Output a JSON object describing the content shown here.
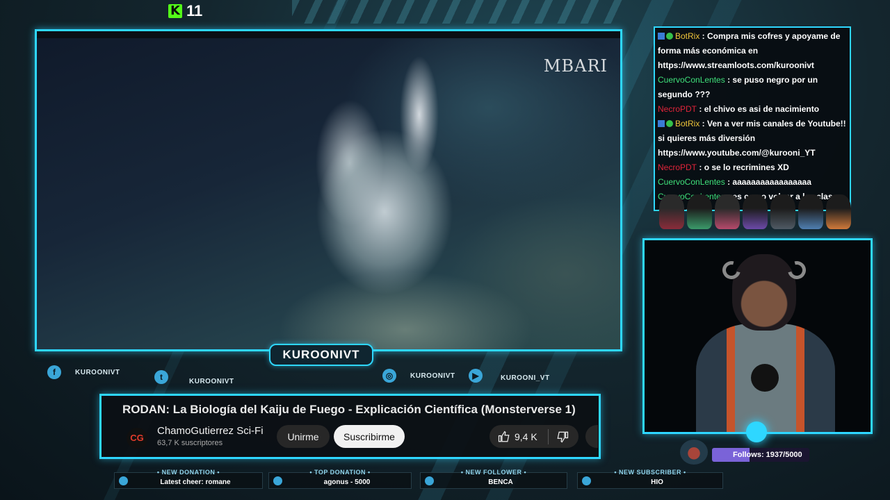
{
  "kick": {
    "count": "11"
  },
  "video": {
    "watermark": "MBARI"
  },
  "channel_tag": "KUROONIVT",
  "socials": [
    {
      "icon": "facebook-icon",
      "glyph": "f",
      "label": "KUROONIVT"
    },
    {
      "icon": "twitter-icon",
      "glyph": "t",
      "label": "KUROONIVT"
    },
    {
      "icon": "instagram-icon",
      "glyph": "◎",
      "label": "KUROONIVT"
    },
    {
      "icon": "youtube-icon",
      "glyph": "▶",
      "label": "KUROONI_VT"
    }
  ],
  "youtube": {
    "title": "RODAN: La Biología del Kaiju de Fuego - Explicación Científica (Monsterverse 1)",
    "avatar_text": "CG",
    "channel": "ChamoGutierrez Sci-Fi",
    "subscribers": "63,7 K suscriptores",
    "join_label": "Unirme",
    "subscribe_label": "Suscribirme",
    "likes": "9,4 K"
  },
  "chat": {
    "messages": [
      {
        "user": "BotRix",
        "user_color": "#f0c53a",
        "badges": true,
        "text": "Compra mis cofres y apoyame de forma más económica en https://www.streamloots.com/kuroonivt"
      },
      {
        "user": "CuervoConLentes",
        "user_color": "#3fe07a",
        "badges": false,
        "text": "se puso negro por un segundo ???"
      },
      {
        "user": "NecroPDT",
        "user_color": "#e0243a",
        "badges": false,
        "text": "el chivo es asi de nacimiento"
      },
      {
        "user": "BotRix",
        "user_color": "#f0c53a",
        "badges": true,
        "text": "Ven a ver mis canales de Youtube!! si quieres más diversión https://www.youtube.com/@kurooni_YT"
      },
      {
        "user": "NecroPDT",
        "user_color": "#e0243a",
        "badges": false,
        "text": "o se lo recrimines XD"
      },
      {
        "user": "CuervoConLentes",
        "user_color": "#3fe07a",
        "badges": false,
        "text": "aaaaaaaaaaaaaaaaa"
      },
      {
        "user": "CuervoConLentes",
        "user_color": "#3fe07a",
        "badges": false,
        "text": "es como volver a las clases de biología"
      }
    ]
  },
  "follows": {
    "label": "Follows:",
    "value": "1937/5000",
    "progress": 0.3874
  },
  "alerts": [
    {
      "heading": "• NEW DONATION •",
      "value": "Latest cheer: romane"
    },
    {
      "heading": "• TOP DONATION •",
      "value": "agonus - 5000"
    },
    {
      "heading": "• NEW FOLLOWER •",
      "value": "BENCA"
    },
    {
      "heading": "• NEW SUBSCRIBER •",
      "value": "HIO"
    }
  ],
  "colors": {
    "accent": "#2ed7ff",
    "kick_green": "#53fc18",
    "follow_bar": "#7a63d8"
  }
}
